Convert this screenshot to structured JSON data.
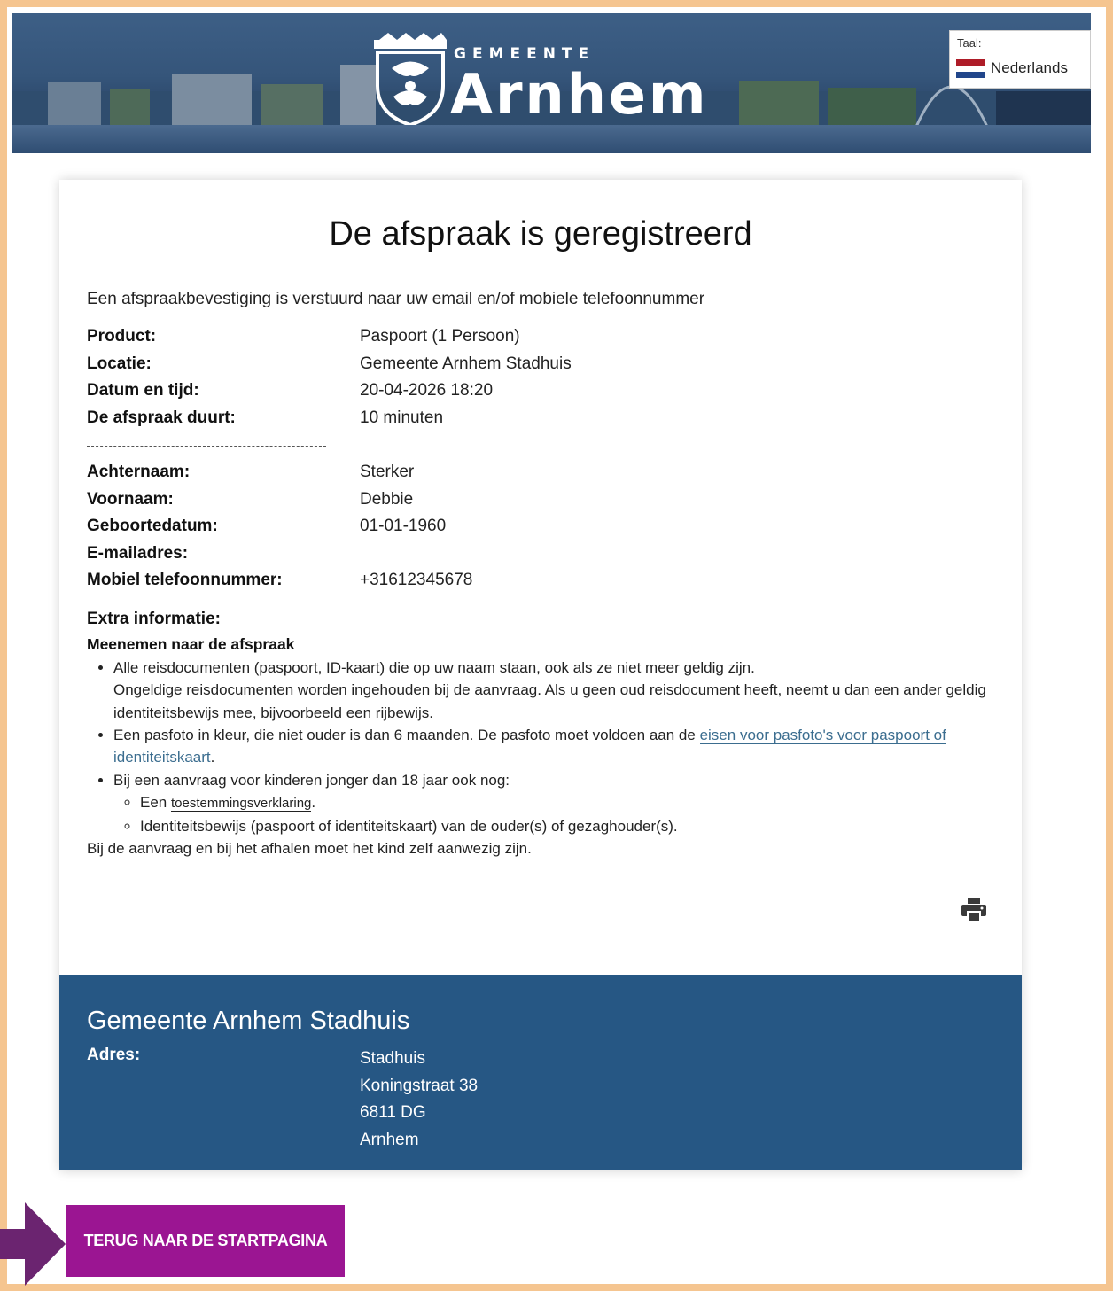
{
  "header": {
    "logo_small": "GEMEENTE",
    "logo_big": "Arnhem",
    "language": {
      "label": "Taal:",
      "value": "Nederlands",
      "flag_colors": [
        "#ae1c28",
        "#ffffff",
        "#21468b"
      ]
    }
  },
  "confirmation": {
    "title": "De afspraak is geregistreerd",
    "intro": "Een afspraakbevestiging is verstuurd naar uw email en/of mobiele telefoonnummer",
    "appointment": [
      {
        "label": "Product:",
        "value": "Paspoort (1 Persoon)"
      },
      {
        "label": "Locatie:",
        "value": "Gemeente Arnhem Stadhuis"
      },
      {
        "label": "Datum en tijd:",
        "value": "20-04-2026 18:20"
      },
      {
        "label": "De afspraak duurt:",
        "value": "10 minuten"
      }
    ],
    "person": [
      {
        "label": "Achternaam:",
        "value": "Sterker"
      },
      {
        "label": "Voornaam:",
        "value": "Debbie"
      },
      {
        "label": "Geboortedatum:",
        "value": "01-01-1960"
      },
      {
        "label": "E-mailadres:",
        "value": ""
      },
      {
        "label": "Mobiel telefoonnummer:",
        "value": "+31612345678"
      }
    ],
    "extra": {
      "heading": "Extra informatie:",
      "subheading": "Meenemen naar de afspraak",
      "item1_line1": "Alle reisdocumenten (paspoort, ID-kaart) die op uw naam staan, ook als ze niet meer geldig zijn.",
      "item1_line2": "Ongeldige reisdocumenten worden ingehouden bij de aanvraag. Als u geen oud reisdocument heeft, neemt u dan een ander geldig identiteitsbewijs mee, bijvoorbeeld een rijbewijs.",
      "item2_text": "Een pasfoto in kleur, die niet ouder is dan 6 maanden. De pasfoto moet voldoen aan de ",
      "item2_link": "eisen voor pasfoto's voor paspoort of identiteitskaart",
      "item2_end": ".",
      "item3_text": "Bij een aanvraag voor kinderen jonger dan 18 jaar ook nog:",
      "sub1_text": "Een ",
      "sub1_link": "toestemmingsverklaring",
      "sub1_end": ".",
      "sub2_text": "Identiteitsbewijs (paspoort of identiteitskaart) van de ouder(s) of gezaghouder(s).",
      "closing": "Bij de aanvraag en bij het afhalen moet het kind zelf aanwezig zijn."
    }
  },
  "location": {
    "name": "Gemeente Arnhem Stadhuis",
    "address_label": "Adres:",
    "address_lines": [
      "Stadhuis",
      "Koningstraat 38",
      "6811 DG",
      "Arnhem"
    ]
  },
  "actions": {
    "back_label": "TERUG NAAR DE STARTPAGINA"
  },
  "colors": {
    "accent": "#9b1592",
    "footer": "#265784",
    "frame": "#f5c590"
  }
}
